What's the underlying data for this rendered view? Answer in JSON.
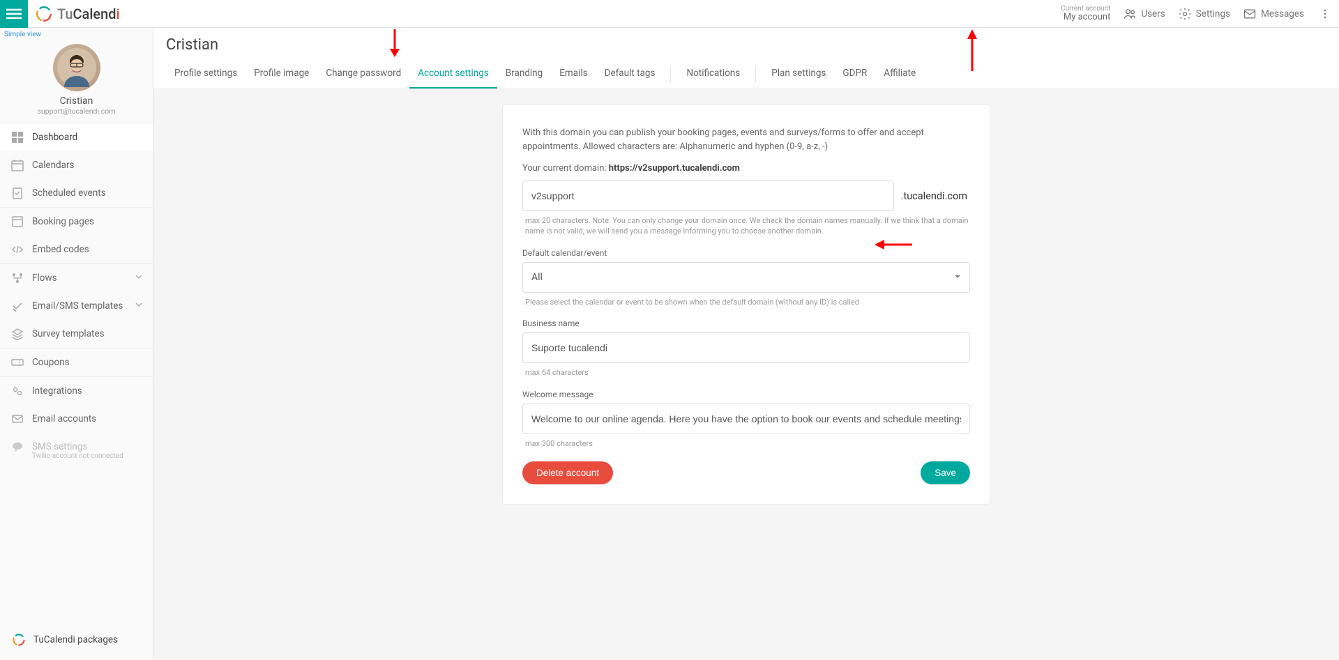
{
  "brand": {
    "tu": "Tu",
    "calend": "Calend",
    "i": "i"
  },
  "topbar": {
    "account_label": "Current account",
    "account_value": "My account",
    "users": "Users",
    "settings": "Settings",
    "messages": "Messages"
  },
  "sidebar": {
    "simple_view": "Simple view",
    "profile_name": "Cristian",
    "profile_email": "support@tucalendi.com",
    "items": {
      "dashboard": "Dashboard",
      "calendars": "Calendars",
      "scheduled": "Scheduled events",
      "booking": "Booking pages",
      "embed": "Embed codes",
      "flows": "Flows",
      "templates": "Email/SMS templates",
      "survey": "Survey templates",
      "coupons": "Coupons",
      "integrations": "Integrations",
      "email_accounts": "Email accounts",
      "sms_settings": "SMS settings",
      "sms_sub": "Twilio account not connected"
    },
    "packages": "TuCalendi packages"
  },
  "page_title": "Cristian",
  "tabs": {
    "profile": "Profile settings",
    "image": "Profile image",
    "password": "Change password",
    "account": "Account settings",
    "branding": "Branding",
    "emails": "Emails",
    "default_tags": "Default tags",
    "notifications": "Notifications",
    "plan": "Plan settings",
    "gdpr": "GDPR",
    "affiliate": "Affiliate"
  },
  "form": {
    "desc": "With this domain you can publish your booking pages, events and surveys/forms to offer and accept appointments. Allowed characters are: Alphanumeric and hyphen (0-9, a-z, -)",
    "current_domain_label": "Your current domain: ",
    "current_domain_value": "https://v2support.tucalendi.com",
    "domain_value": "v2support",
    "domain_suffix": ".tucalendi.com",
    "domain_hint": "max 20 characters. Note: You can only change your domain once. We check the domain names manually. If we think that a domain name is not valid, we will send you a message informing you to choose another domain.",
    "default_cal_label": "Default calendar/event",
    "default_cal_value": "All",
    "default_cal_hint": "Please select the calendar or event to be shown when the default domain (without any ID) is called",
    "business_label": "Business name",
    "business_value": "Suporte tucalendi",
    "business_hint": "max 64 characters",
    "welcome_label": "Welcome message",
    "welcome_value": "Welcome to our online agenda. Here you have the option to book our events and schedule meetings with us.",
    "welcome_hint": "max 300 characters",
    "delete_btn": "Delete account",
    "save_btn": "Save"
  }
}
